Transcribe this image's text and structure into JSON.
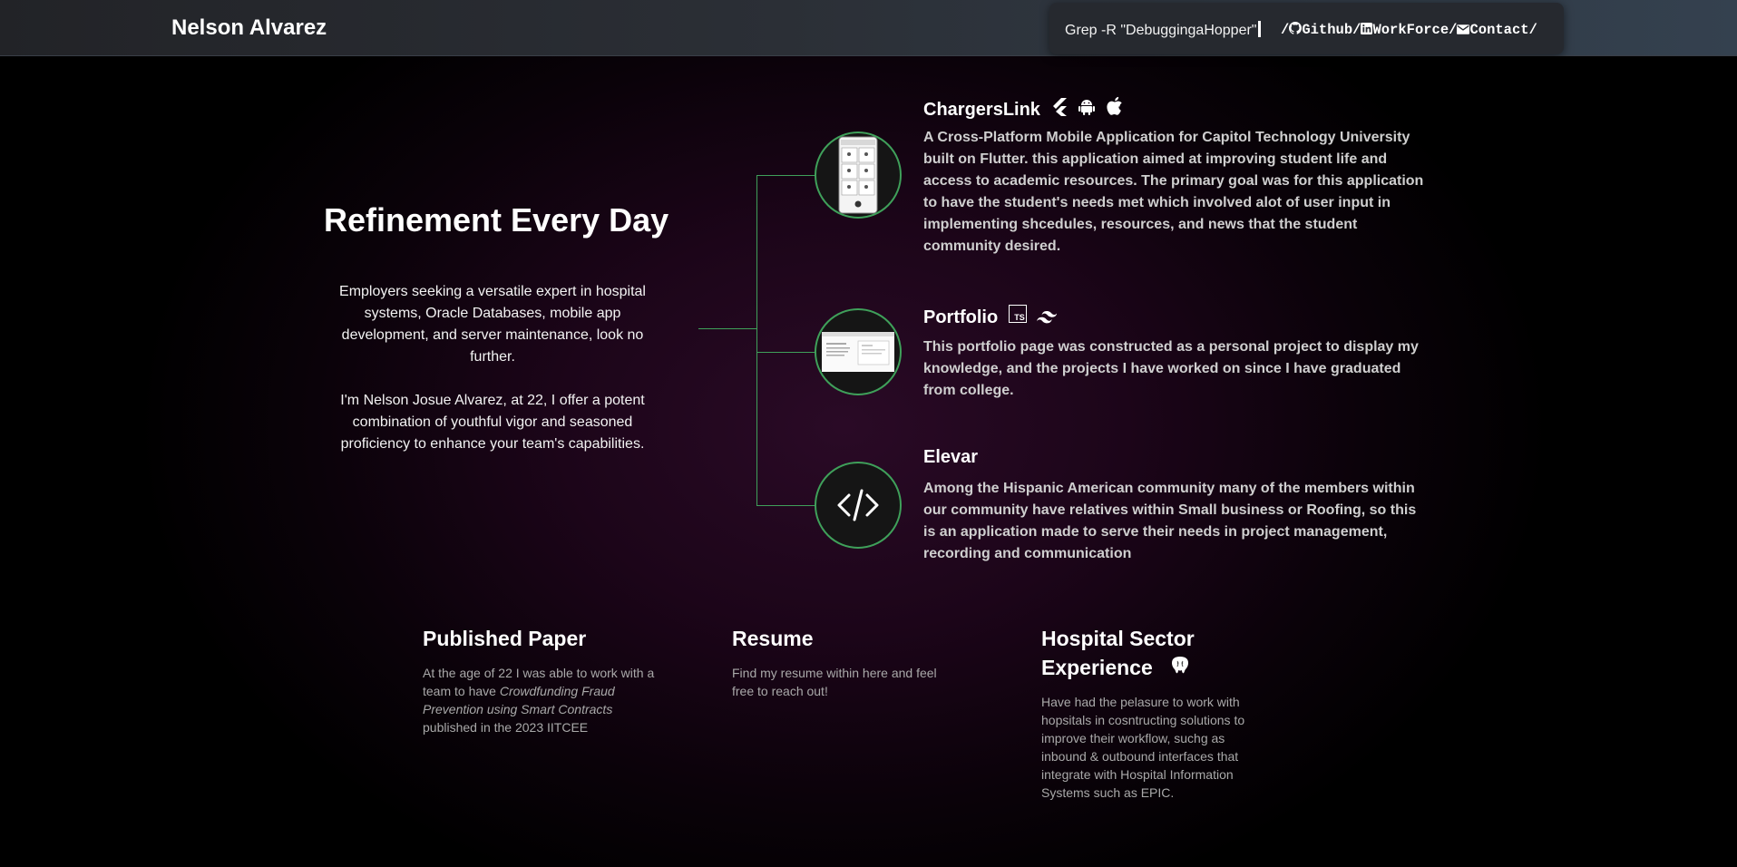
{
  "header": {
    "brand": "Nelson Alvarez",
    "command": "Grep -R \"DebuggingaHopper\"",
    "nav": {
      "sep": "/",
      "github": "Github",
      "workforce": "WorkForce",
      "contact": "Contact"
    }
  },
  "hero": {
    "title": "Refinement Every Day",
    "paragraph1": "Employers seeking a versatile expert in hospital systems, Oracle Databases, mobile app development, and server maintenance, look no further.",
    "paragraph2": "I'm Nelson Josue Alvarez, at 22, I offer a potent combination of youthful vigor and seasoned proficiency to enhance your team's capabilities."
  },
  "projects": [
    {
      "title": "ChargersLink",
      "icons": [
        "flutter-icon",
        "android-icon",
        "apple-icon"
      ],
      "description": "A Cross-Platform Mobile Application for Capitol Technology University built on Flutter. this application aimed at improving student life and access to academic resources. The primary goal was for this application to have the student's needs met which involved alot of user input in implementing shcedules, resources, and news that the student community desired."
    },
    {
      "title": "Portfolio",
      "icons": [
        "typescript-icon",
        "tailwind-icon"
      ],
      "typescript_badge": "TS",
      "description": "This portfolio page was constructed as a personal project to display my knowledge, and the projects I have worked on since I have graduated from college."
    },
    {
      "title": "Elevar",
      "icons": [
        "code-icon"
      ],
      "description": "Among the Hispanic American community many of the members within our community have relatives within Small business or Roofing, so this is an application made to serve their needs in project management, recording and communication"
    }
  ],
  "cards": {
    "paper": {
      "title": "Published Paper",
      "text_before": "At the age of 22 I was able to work with a team to have ",
      "text_italic": "Crowdfunding Fraud Prevention using Smart Contracts",
      "text_after": " published in the 2023 IITCEE"
    },
    "resume": {
      "title": "Resume",
      "text": "Find my resume within here and feel free to reach out!"
    },
    "hospital": {
      "title_line1": "Hospital Sector",
      "title_line2": "Experience",
      "icon": "postgresql-icon",
      "text": "Have had the pelasure to work with hopsitals in cosntructing solutions to improve their workflow, suchg as inbound & outbound interfaces that integrate with Hospital Information Systems such as EPIC."
    }
  },
  "colors": {
    "accent_line": "#3fa05a",
    "header_bg": "#2b2f36",
    "background": "#1c0519"
  }
}
